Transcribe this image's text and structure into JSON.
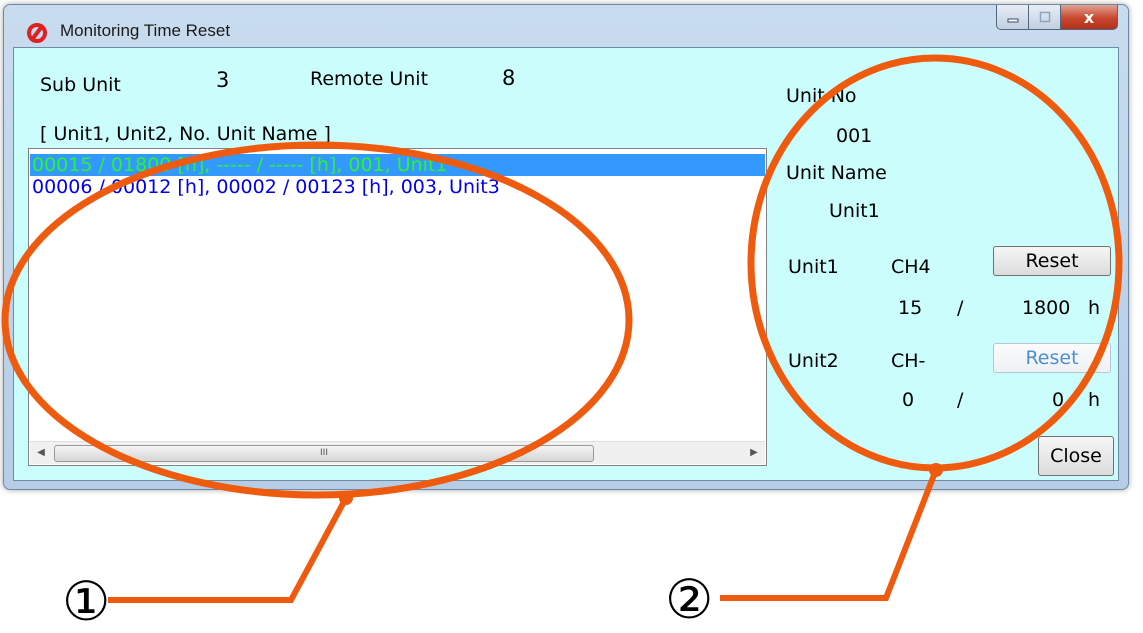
{
  "window": {
    "title": "Monitoring Time Reset",
    "app_icon": "red-slash-icon",
    "caption_buttons": {
      "minimize": "",
      "maximize": "",
      "close": "x"
    }
  },
  "header": {
    "sub_unit_label": "Sub Unit",
    "sub_unit_value": "3",
    "remote_unit_label": "Remote Unit",
    "remote_unit_value": "8",
    "list_caption": "[ Unit1, Unit2, No. Unit Name ]"
  },
  "list": {
    "rows": [
      "00015 / 01800 [h], ----- / ----- [h], 001, Unit1",
      "00006 / 00012 [h], 00002 / 00123 [h], 003, Unit3"
    ],
    "selected_index": 0,
    "scroll_thumb_grip": "III",
    "scroll_left": "◀",
    "scroll_right": "▶"
  },
  "details": {
    "unit_no_label": "Unit No",
    "unit_no_value": "001",
    "unit_name_label": "Unit Name",
    "unit_name_value": "Unit1",
    "unit1": {
      "label": "Unit1",
      "channel": "CH4",
      "reset_label": "Reset",
      "used": "15",
      "sep": "/",
      "limit": "1800",
      "unit": "h"
    },
    "unit2": {
      "label": "Unit2",
      "channel": "CH-",
      "reset_label": "Reset",
      "used": "0",
      "sep": "/",
      "limit": "0",
      "unit": "h"
    },
    "close_label": "Close"
  },
  "annotations": {
    "callout_1": "①",
    "callout_2": "②",
    "color": "#ee5b0f"
  },
  "colors": {
    "client_background": "#cbfdfd",
    "selected_row_bg": "#3399ff",
    "selected_row_text": "#2cf52c",
    "row_text": "#0000ee",
    "disabled_button_text": "#4d8fd4"
  }
}
